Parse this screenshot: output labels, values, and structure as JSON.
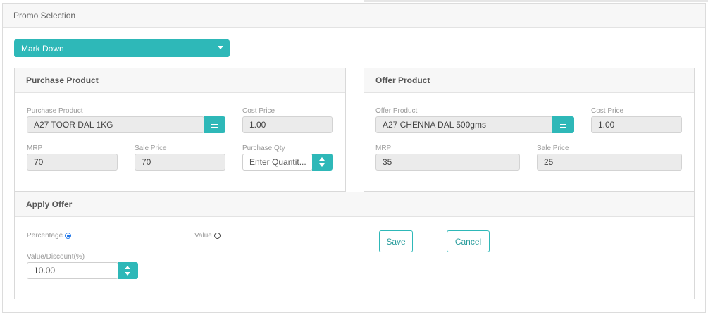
{
  "promo": {
    "title": "Promo Selection",
    "selected": "Mark Down"
  },
  "purchase": {
    "title": "Purchase Product",
    "product_label": "Purchase Product",
    "product_value": "A27 TOOR DAL 1KG",
    "cost_label": "Cost Price",
    "cost_value": "1.00",
    "mrp_label": "MRP",
    "mrp_value": "70",
    "sale_label": "Sale Price",
    "sale_value": "70",
    "qty_label": "Purchase Qty",
    "qty_placeholder": "Enter Quantit..."
  },
  "offer": {
    "title": "Offer Product",
    "product_label": "Offer Product",
    "product_value": "A27 CHENNA DAL 500gms",
    "cost_label": "Cost Price",
    "cost_value": "1.00",
    "mrp_label": "MRP",
    "mrp_value": "35",
    "sale_label": "Sale Price",
    "sale_value": "25"
  },
  "apply": {
    "title": "Apply Offer",
    "percentage_label": "Percentage",
    "value_label": "Value",
    "selected_mode": "percentage",
    "discount_label": "Value/Discount(%)",
    "discount_value": "10.00",
    "save_label": "Save",
    "cancel_label": "Cancel"
  },
  "colors": {
    "accent": "#2eb8b8",
    "radio_selected": "#1a73e8"
  }
}
